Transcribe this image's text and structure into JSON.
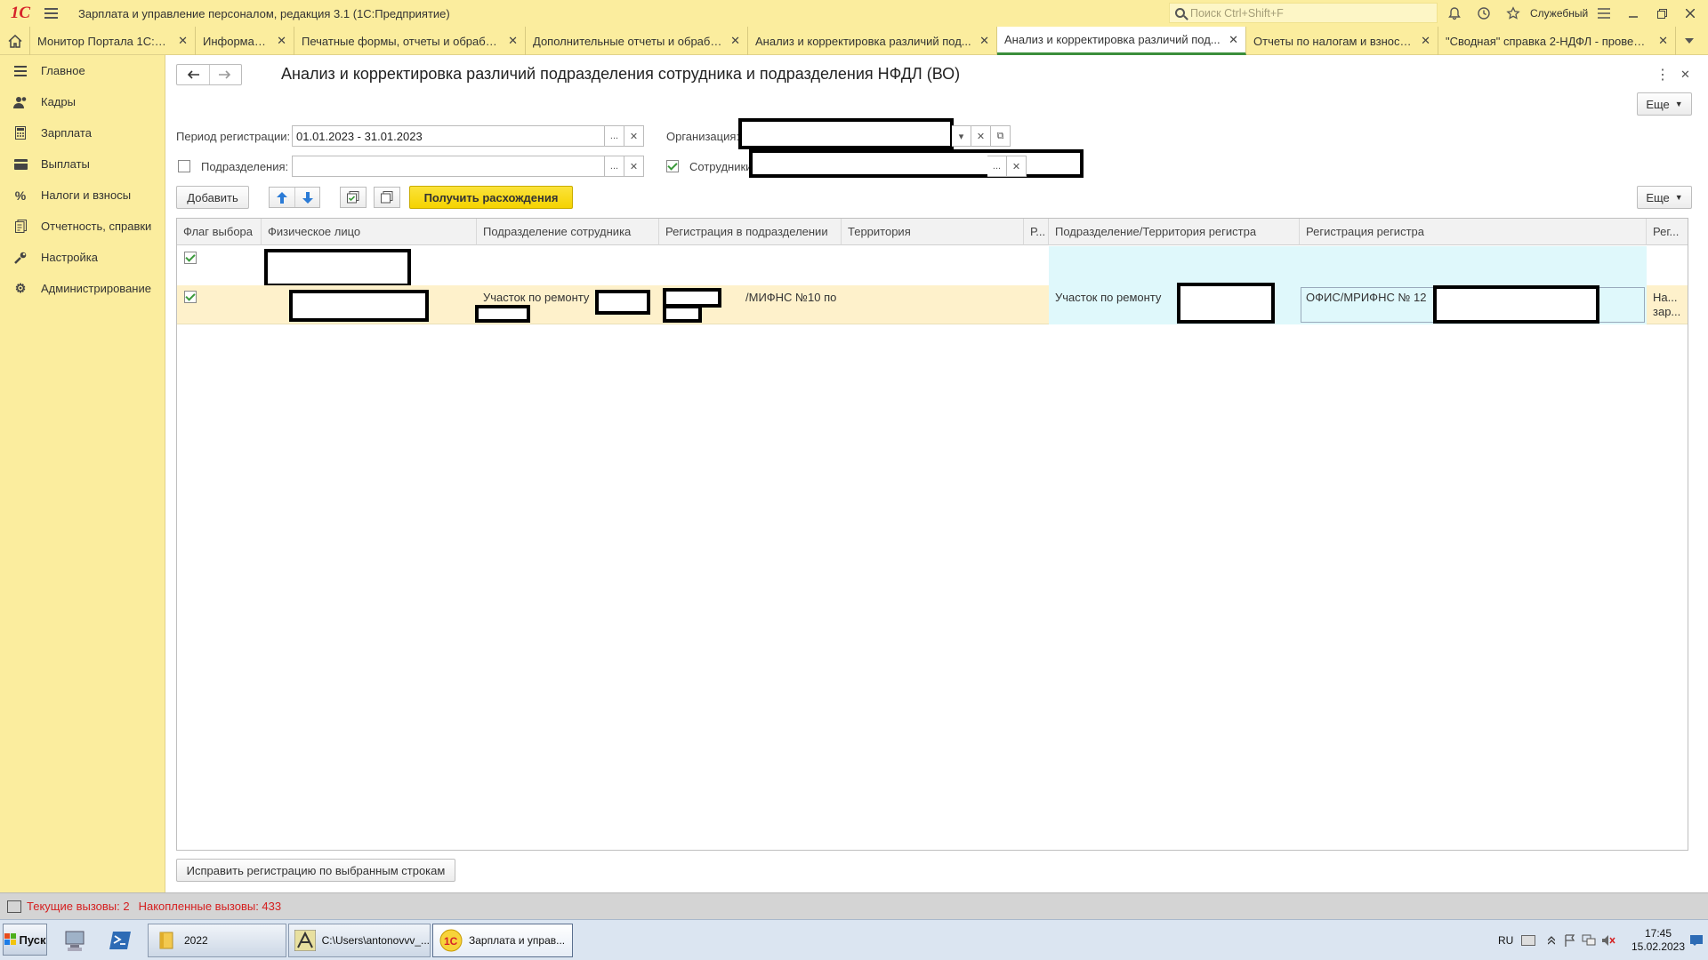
{
  "titlebar": {
    "logo": "1С",
    "app_title": "Зарплата и управление персоналом, редакция 3.1  (1С:Предприятие)",
    "search_placeholder": "Поиск Ctrl+Shift+F",
    "service_label": "Служебный"
  },
  "tabs": [
    {
      "label": "Монитор Портала 1С:ИТС"
    },
    {
      "label": "Информация"
    },
    {
      "label": "Печатные формы, отчеты и обработки"
    },
    {
      "label": "Дополнительные отчеты и обработки"
    },
    {
      "label": "Анализ и корректировка различий под..."
    },
    {
      "label": "Анализ и корректировка различий под..."
    },
    {
      "label": "Отчеты по налогам и взносам"
    },
    {
      "label": "\"Сводная\" справка 2-НДФЛ - проверка"
    }
  ],
  "sidebar": {
    "items": [
      {
        "label": "Главное",
        "icon": "menu-lines-icon"
      },
      {
        "label": "Кадры",
        "icon": "people-icon"
      },
      {
        "label": "Зарплата",
        "icon": "calculator-icon"
      },
      {
        "label": "Выплаты",
        "icon": "wallet-icon"
      },
      {
        "label": "Налоги и взносы",
        "icon": "percent-icon"
      },
      {
        "label": "Отчетность, справки",
        "icon": "report-icon"
      },
      {
        "label": "Настройка",
        "icon": "wrench-icon"
      },
      {
        "label": "Администрирование",
        "icon": "gear-icon"
      }
    ]
  },
  "form": {
    "title": "Анализ и корректировка различий подразделения сотрудника и подразделения НФДЛ (ВО)",
    "more_label": "Еще",
    "period_label": "Период регистрации:",
    "period_value": "01.01.2023 - 31.01.2023",
    "org_label": "Организация:",
    "dept_label": "Подразделения:",
    "dept_value": "",
    "emp_label": "Сотрудники:",
    "add_label": "Добавить",
    "get_label": "Получить расхождения",
    "fix_label": "Исправить регистрацию по выбранным строкам"
  },
  "table": {
    "columns": [
      "Флаг выбора",
      "Физическое лицо",
      "Подразделение сотрудника",
      "Регистрация в подразделении",
      "Территория",
      "Р...",
      "Подразделение/Территория регистра",
      "Регистрация регистра",
      "Рег..."
    ],
    "rows": [
      {
        "c1": "",
        "c2": "",
        "c3": "",
        "c4": "",
        "c6": "",
        "c7": "",
        "c8": ""
      },
      {
        "c1": "",
        "c2": "Участок по ремонту",
        "c3": "/МИФНС №10 по",
        "c4": "",
        "c6": "Участок по ремонту",
        "c7": "ОФИС/МРИФНС № 12",
        "c8a": "На...",
        "c8b": "зар..."
      }
    ]
  },
  "status": {
    "current": "Текущие вызовы: 2",
    "accumulated": "Накопленные вызовы: 433"
  },
  "taskbar": {
    "start": "Пуск",
    "tasks": [
      {
        "label": "2022"
      },
      {
        "label": "C:\\Users\\antonovvv_..."
      },
      {
        "label": "Зарплата и управ..."
      }
    ],
    "lang": "RU",
    "time": "17:45",
    "date": "15.02.2023"
  }
}
